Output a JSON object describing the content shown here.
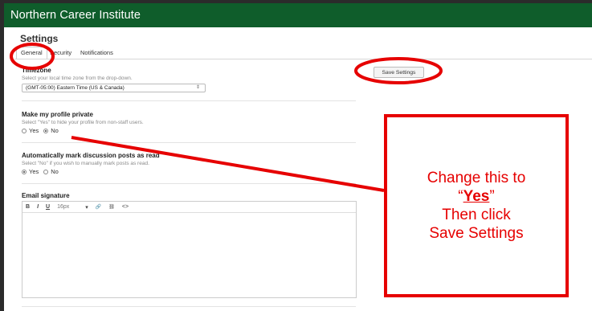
{
  "app": {
    "title": "Northern Career Institute"
  },
  "page": {
    "title": "Settings"
  },
  "tabs": [
    {
      "label": "General"
    },
    {
      "label": "Security"
    },
    {
      "label": "Notifications"
    }
  ],
  "timezone": {
    "title": "Timezone",
    "help": "Select your local time zone from the drop-down.",
    "value": "(GMT-05:00) Eastern Time (US & Canada)"
  },
  "profile_private": {
    "title": "Make my profile private",
    "help": "Select \"Yes\" to hide your profile from non-staff users.",
    "options": [
      "Yes",
      "No"
    ],
    "selected": "No"
  },
  "auto_mark": {
    "title": "Automatically mark discussion posts as read",
    "help": "Select \"No\" if you wish to manually mark posts as read.",
    "options": [
      "Yes",
      "No"
    ],
    "selected": "Yes"
  },
  "signature": {
    "title": "Email signature",
    "toolbar": {
      "bold": "B",
      "italic": "I",
      "underline": "U",
      "font_size": "16px",
      "caret": "▾",
      "link": "🔗",
      "unlink": "⛓",
      "code": "<>"
    }
  },
  "save_button": {
    "label": "Save Settings"
  },
  "callout": {
    "line1": "Change this to",
    "open_quote": "“",
    "emphasis": "Yes",
    "close_quote": "”",
    "line3": "Then click",
    "line4": "Save Settings"
  },
  "colors": {
    "header": "#0f5d2b",
    "annotation": "#e60000"
  },
  "icons": {
    "select_caret": "⇕"
  }
}
